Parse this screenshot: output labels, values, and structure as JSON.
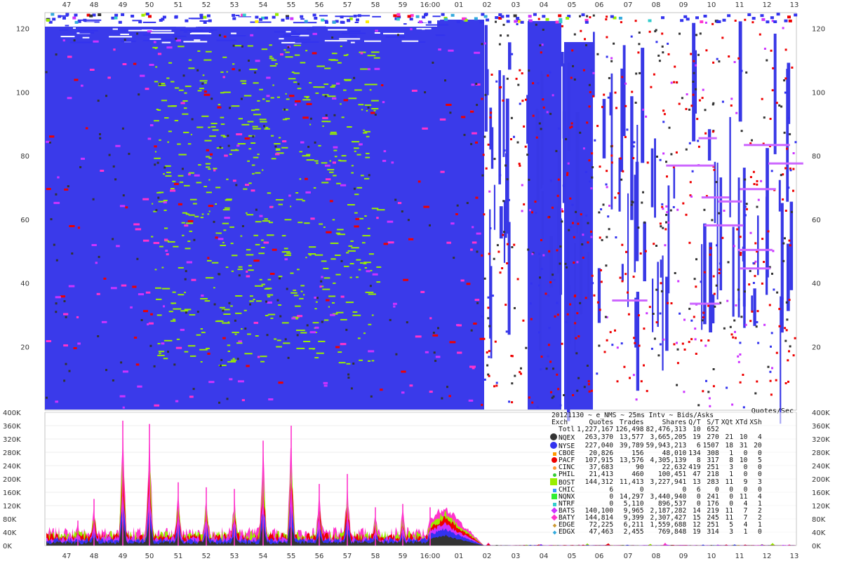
{
  "chart_data": [
    {
      "type": "scatter",
      "title": "",
      "x_ticks": [
        "47",
        "48",
        "49",
        "50",
        "51",
        "52",
        "53",
        "54",
        "55",
        "56",
        "57",
        "58",
        "59",
        "16:00",
        "01",
        "02",
        "03",
        "04",
        "05",
        "06",
        "07",
        "08",
        "09",
        "10",
        "11",
        "12",
        "13"
      ],
      "y_ticks": [
        "20",
        "40",
        "60",
        "80",
        "100",
        "120"
      ],
      "ylim": [
        0,
        125
      ],
      "description_of_marks": "dense bid/ask quote markers per exchange; dominant colors blue, yellow-green, red, magenta",
      "series_colors": {
        "NQEX": "#333333",
        "NYSE": "#3333ee",
        "CBOE": "#ff9900",
        "PACF": "#ee0000",
        "CINC": "#ff9933",
        "PHIL": "#33cc33",
        "BOST": "#99ee00",
        "CHIC": "#3399ff",
        "NQNX": "#33ee33",
        "NTRF": "#33cccc",
        "BATS": "#cc33ff",
        "BATY": "#ff33cc",
        "EDGE": "#cc9933",
        "EDGX": "#33aadd"
      }
    },
    {
      "type": "area",
      "title": "Quotes/Sec",
      "x_ticks": [
        "47",
        "48",
        "49",
        "50",
        "51",
        "52",
        "53",
        "54",
        "55",
        "56",
        "57",
        "58",
        "59",
        "16:00",
        "01",
        "02",
        "03",
        "04",
        "05",
        "06",
        "07",
        "08",
        "09",
        "10",
        "11",
        "12",
        "13"
      ],
      "y_ticks": [
        "0K",
        "40K",
        "80K",
        "120K",
        "160K",
        "200K",
        "240K",
        "280K",
        "320K",
        "360K",
        "400K"
      ],
      "ylim": [
        0,
        400000
      ],
      "ylabel": "Quotes/Sec",
      "spikes": [
        {
          "x": "47.4",
          "y": 75000
        },
        {
          "x": "48",
          "y": 140000
        },
        {
          "x": "49",
          "y": 375000
        },
        {
          "x": "50",
          "y": 365000
        },
        {
          "x": "51",
          "y": 190000
        },
        {
          "x": "52",
          "y": 175000
        },
        {
          "x": "53",
          "y": 170000
        },
        {
          "x": "54",
          "y": 315000
        },
        {
          "x": "55",
          "y": 360000
        },
        {
          "x": "56",
          "y": 185000
        },
        {
          "x": "57",
          "y": 215000
        },
        {
          "x": "58",
          "y": 115000
        },
        {
          "x": "59",
          "y": 125000
        },
        {
          "x": "16:00",
          "y": 115000
        }
      ],
      "baseline": {
        "pre_close": 45000,
        "close_burst_peak": 160000,
        "after_close": 2000
      }
    }
  ],
  "stats": {
    "title": "20121130 ~ e_NMS ~ 25ms Intv ~ Bids/Asks",
    "columns": [
      "Exch",
      "Quotes",
      "Trades",
      "Shares",
      "Q/T",
      "S/T",
      "XQt",
      "XTd",
      "XSh"
    ],
    "rows": [
      {
        "exch": "Totl",
        "quotes": "1,227,167",
        "trades": "126,498",
        "shares": "82,476,313",
        "qt": "10",
        "st": "652",
        "xqt": "",
        "xtd": "",
        "xsh": "",
        "marker": "none",
        "color": ""
      },
      {
        "exch": "NQEX",
        "quotes": "263,370",
        "trades": "13,577",
        "shares": "3,665,205",
        "qt": "19",
        "st": "270",
        "xqt": "21",
        "xtd": "10",
        "xsh": "4",
        "marker": "circle-big",
        "color": "#333333"
      },
      {
        "exch": "NYSE",
        "quotes": "227,040",
        "trades": "39,789",
        "shares": "59,943,213",
        "qt": "6",
        "st": "1507",
        "xqt": "18",
        "xtd": "31",
        "xsh": "20",
        "marker": "circle-big",
        "color": "#3333ee"
      },
      {
        "exch": "CBOE",
        "quotes": "20,826",
        "trades": "156",
        "shares": "48,010",
        "qt": "134",
        "st": "308",
        "xqt": "1",
        "xtd": "0",
        "xsh": "0",
        "marker": "small",
        "color": "#ff9900"
      },
      {
        "exch": "PACF",
        "quotes": "107,915",
        "trades": "13,576",
        "shares": "4,305,139",
        "qt": "8",
        "st": "317",
        "xqt": "8",
        "xtd": "10",
        "xsh": "5",
        "marker": "circle",
        "color": "#ee0000"
      },
      {
        "exch": "CINC",
        "quotes": "37,683",
        "trades": "90",
        "shares": "22,632",
        "qt": "419",
        "st": "251",
        "xqt": "3",
        "xtd": "0",
        "xsh": "0",
        "marker": "circle-small",
        "color": "#ff9933"
      },
      {
        "exch": "PHIL",
        "quotes": "21,413",
        "trades": "460",
        "shares": "100,451",
        "qt": "47",
        "st": "218",
        "xqt": "1",
        "xtd": "0",
        "xsh": "0",
        "marker": "circle-small",
        "color": "#33cc33"
      },
      {
        "exch": "BOST",
        "quotes": "144,312",
        "trades": "11,413",
        "shares": "3,227,941",
        "qt": "13",
        "st": "283",
        "xqt": "11",
        "xtd": "9",
        "xsh": "3",
        "marker": "square-big",
        "color": "#99ee00"
      },
      {
        "exch": "CHIC",
        "quotes": "6",
        "trades": "0",
        "shares": "0",
        "qt": "6",
        "st": "0",
        "xqt": "0",
        "xtd": "0",
        "xsh": "0",
        "marker": "small",
        "color": "#3399ff"
      },
      {
        "exch": "NQNX",
        "quotes": "0",
        "trades": "14,297",
        "shares": "3,440,940",
        "qt": "0",
        "st": "241",
        "xqt": "0",
        "xtd": "11",
        "xsh": "4",
        "marker": "square",
        "color": "#33ee33"
      },
      {
        "exch": "NTRF",
        "quotes": "0",
        "trades": "5,110",
        "shares": "896,537",
        "qt": "0",
        "st": "176",
        "xqt": "0",
        "xtd": "4",
        "xsh": "1",
        "marker": "small",
        "color": "#33cccc"
      },
      {
        "exch": "BATS",
        "quotes": "140,100",
        "trades": "9,965",
        "shares": "2,187,282",
        "qt": "14",
        "st": "219",
        "xqt": "11",
        "xtd": "7",
        "xsh": "2",
        "marker": "diamond",
        "color": "#cc33ff"
      },
      {
        "exch": "BATY",
        "quotes": "144,814",
        "trades": "9,399",
        "shares": "2,307,427",
        "qt": "15",
        "st": "245",
        "xqt": "11",
        "xtd": "7",
        "xsh": "2",
        "marker": "diamond",
        "color": "#ff33cc"
      },
      {
        "exch": "EDGE",
        "quotes": "72,225",
        "trades": "6,211",
        "shares": "1,559,688",
        "qt": "12",
        "st": "251",
        "xqt": "5",
        "xtd": "4",
        "xsh": "1",
        "marker": "diamond-small",
        "color": "#cc9933"
      },
      {
        "exch": "EDGX",
        "quotes": "47,463",
        "trades": "2,455",
        "shares": "769,848",
        "qt": "19",
        "st": "314",
        "xqt": "3",
        "xtd": "1",
        "xsh": "0",
        "marker": "diamond-small",
        "color": "#33aadd"
      }
    ]
  },
  "colors": {
    "blue": "#3333ee",
    "green": "#99ee00",
    "red": "#ee0000",
    "magenta": "#ff33cc",
    "purple": "#cc33ff",
    "dark": "#333333",
    "yellow": "#ffee00",
    "cyan": "#33cccc"
  }
}
